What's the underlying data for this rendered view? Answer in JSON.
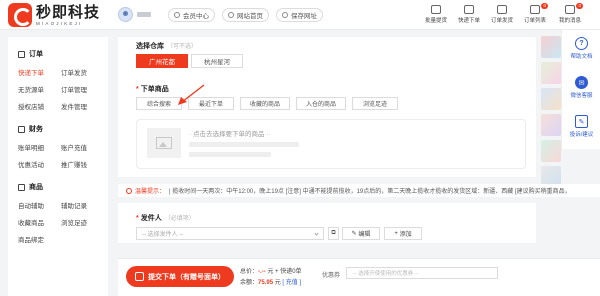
{
  "brand": {
    "name_cn": "秒即科技",
    "name_en": "MIAOJIKEJI"
  },
  "header": {
    "nav": [
      {
        "label": "会员中心",
        "icon": "member-icon"
      },
      {
        "label": "网站首页",
        "icon": "home-icon"
      },
      {
        "label": "保存网址",
        "icon": "bookmark-icon"
      }
    ],
    "tools": [
      {
        "label": "批量提货",
        "icon": "batch-icon",
        "badge": ""
      },
      {
        "label": "快递下单",
        "icon": "express-icon",
        "badge": ""
      },
      {
        "label": "订单发货",
        "icon": "ship-icon",
        "badge": ""
      },
      {
        "label": "订单列表",
        "icon": "list-icon",
        "badge": "0"
      },
      {
        "label": "我的消息",
        "icon": "message-icon",
        "badge": "0"
      }
    ]
  },
  "sidebar": {
    "sections": [
      {
        "title": "订单",
        "items": [
          "快递下单",
          "订单发货",
          "无货源单",
          "订单管理",
          "授权店铺",
          "发件管理"
        ]
      },
      {
        "title": "财务",
        "items": [
          "账单明细",
          "账户充值",
          "优惠活动",
          "推广赚钱"
        ]
      },
      {
        "title": "商品",
        "items": [
          "自动辅助",
          "辅助记录",
          "收藏商品",
          "浏览足迹",
          "商品绑定"
        ]
      }
    ],
    "active_item": "快递下单"
  },
  "warehouse": {
    "label": "选择仓库",
    "optional": "（可不选）",
    "options": [
      "广州花都",
      "杭州星河"
    ],
    "selected": "广州花都"
  },
  "product": {
    "label": "下单商品",
    "tabs": [
      "综合搜索",
      "最近下单",
      "收藏的商品",
      "入仓的商品",
      "浏览足迹"
    ],
    "hint": "· 点击去选择要下单的商品 ·"
  },
  "notice": {
    "prefix": "温馨提示：",
    "text": "| 揽收时间一天两次：中午12:00，晚上19点 [注意] 中通不能提前揽收，19点后的，第二天晚上揽收才揽收的发货区域：新疆、西藏 [建议购买稍重商品，"
  },
  "sender": {
    "label": "发件人",
    "optional": "（必填项）",
    "placeholder": "-- 选择发件人 --",
    "edit_label": "编辑",
    "add_label": "添加"
  },
  "bottom": {
    "submit_label": "提交下单（有赠号面单）",
    "total_prefix": "总价：",
    "total_value": "-.--",
    "total_unit": "元 + 快递",
    "total_count": "0",
    "total_suffix": "单",
    "balance_prefix": "余额：",
    "balance_value": "75.95",
    "balance_unit": "元",
    "recharge_label": "[ 充值 ]",
    "coupon_label": "优惠券",
    "coupon_placeholder": "-- 选择开使使用的优惠券 --"
  },
  "float_tools": [
    {
      "label": "帮助文档",
      "icon": "help-icon",
      "glyph": "?"
    },
    {
      "label": "微信客服",
      "icon": "wechat-icon",
      "glyph": "✉"
    },
    {
      "label": "投诉/建议",
      "icon": "feedback-icon",
      "glyph": "✎"
    }
  ],
  "colors": {
    "accent": "#ee3b1f",
    "link": "#2f5bd3",
    "background": "#f3f4f6"
  }
}
